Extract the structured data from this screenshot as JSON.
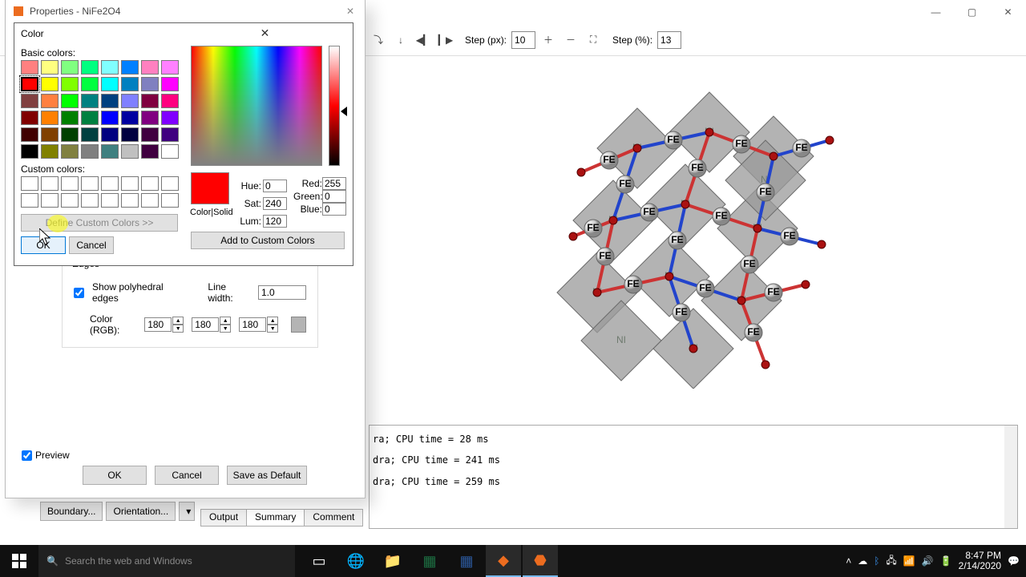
{
  "main_window": {
    "minimize": "—",
    "maximize": "▢",
    "close": "✕"
  },
  "toolbar": {
    "step_px_label": "Step (px):",
    "step_px_value": "10",
    "step_pct_label": "Step (%):",
    "step_pct_value": "13"
  },
  "console_lines": [
    "ra; CPU time = 28 ms",
    "dra; CPU time = 241 ms",
    "dra; CPU time = 259 ms"
  ],
  "output_tabs": {
    "output": "Output",
    "summary": "Summary",
    "comment": "Comment"
  },
  "side_buttons": {
    "boundary": "Boundary...",
    "orientation": "Orientation..."
  },
  "properties": {
    "title": "Properties - NiFe2O4",
    "edges_legend": "Edges",
    "show_poly_label": "Show polyhedral edges",
    "show_poly_checked": true,
    "line_width_label": "Line width:",
    "line_width_value": "1.0",
    "color_rgb_label": "Color (RGB):",
    "rgb": [
      "180",
      "180",
      "180"
    ],
    "preview_label": "Preview",
    "preview_checked": true,
    "buttons": {
      "ok": "OK",
      "cancel": "Cancel",
      "save": "Save as Default"
    }
  },
  "color_dialog": {
    "title": "Color",
    "basic_label": "Basic colors:",
    "custom_label": "Custom colors:",
    "define_label": "Define Custom Colors >>",
    "ok": "OK",
    "cancel": "Cancel",
    "color_solid_label": "Color|Solid",
    "hue_label": "Hue:",
    "hue": "0",
    "sat_label": "Sat:",
    "sat": "240",
    "lum_label": "Lum:",
    "lum": "120",
    "red_label": "Red:",
    "red": "255",
    "green_label": "Green:",
    "green": "0",
    "blue_label": "Blue:",
    "blue": "0",
    "add_label": "Add to Custom Colors",
    "basic_colors": [
      "#ff8080",
      "#ffff80",
      "#80ff80",
      "#00ff80",
      "#80ffff",
      "#0080ff",
      "#ff80c0",
      "#ff80ff",
      "#ff0000",
      "#ffff00",
      "#80ff00",
      "#00ff40",
      "#00ffff",
      "#0080c0",
      "#8080c0",
      "#ff00ff",
      "#804040",
      "#ff8040",
      "#00ff00",
      "#008080",
      "#004080",
      "#8080ff",
      "#800040",
      "#ff0080",
      "#800000",
      "#ff8000",
      "#008000",
      "#008040",
      "#0000ff",
      "#0000a0",
      "#800080",
      "#8000ff",
      "#400000",
      "#804000",
      "#004000",
      "#004040",
      "#000080",
      "#000040",
      "#400040",
      "#400080",
      "#000000",
      "#808000",
      "#808040",
      "#808080",
      "#408080",
      "#c0c0c0",
      "#400040",
      "#ffffff"
    ],
    "selected_basic_index": 8
  },
  "taskbar": {
    "search_placeholder": "Search the web and Windows",
    "time": "8:47 PM",
    "date": "2/14/2020"
  }
}
